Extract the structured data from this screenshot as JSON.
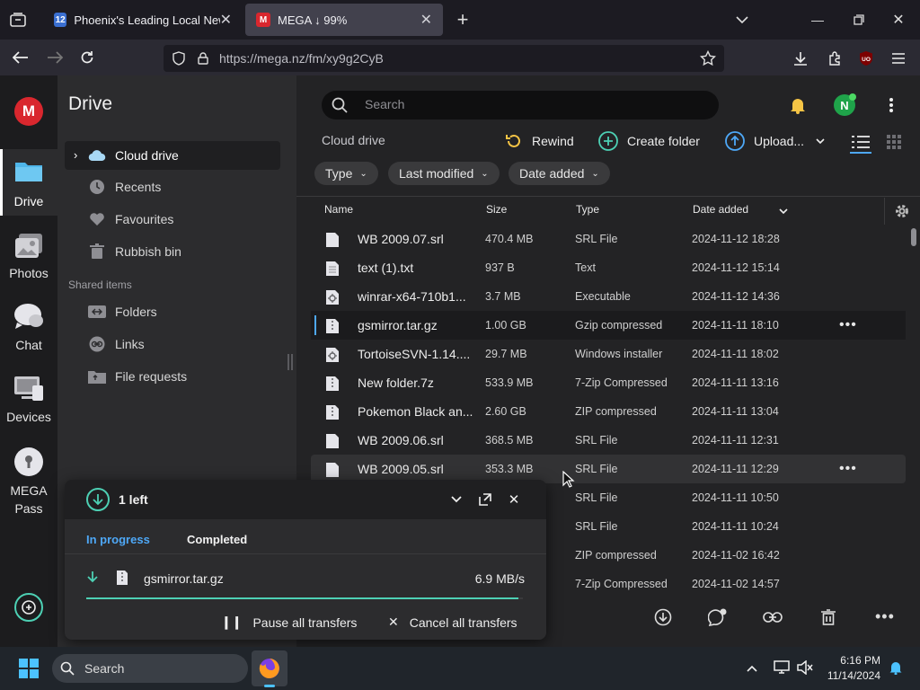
{
  "browser": {
    "tabs": [
      {
        "title": "Phoenix's Leading Local News:",
        "active": false
      },
      {
        "title": "MEGA ↓ 99%",
        "active": true
      }
    ],
    "url": "https://mega.nz/fm/xy9g2CyB"
  },
  "rail": {
    "items": [
      {
        "label": "Drive",
        "icon": "folder-icon",
        "active": true
      },
      {
        "label": "Photos",
        "icon": "photos-icon"
      },
      {
        "label": "Chat",
        "icon": "chat-icon"
      },
      {
        "label": "Devices",
        "icon": "devices-icon"
      },
      {
        "label": "MEGA Pass",
        "icon": "pass-icon"
      }
    ]
  },
  "sidebar": {
    "title": "Drive",
    "items": [
      {
        "label": "Cloud drive",
        "icon": "cloud-icon"
      },
      {
        "label": "Recents",
        "icon": "clock-icon"
      },
      {
        "label": "Favourites",
        "icon": "heart-icon"
      },
      {
        "label": "Rubbish bin",
        "icon": "trash-icon"
      }
    ],
    "shared_title": "Shared items",
    "shared_items": [
      {
        "label": "Folders",
        "icon": "shared-folder-icon"
      },
      {
        "label": "Links",
        "icon": "link-icon"
      },
      {
        "label": "File requests",
        "icon": "file-request-icon"
      }
    ]
  },
  "topbar": {
    "search_placeholder": "Search",
    "avatar_letter": "N"
  },
  "toolbar": {
    "breadcrumb": "Cloud drive",
    "rewind": "Rewind",
    "create_folder": "Create folder",
    "upload": "Upload..."
  },
  "filters": [
    "Type",
    "Last modified",
    "Date added"
  ],
  "table": {
    "columns": {
      "name": "Name",
      "size": "Size",
      "type": "Type",
      "date": "Date added"
    },
    "rows": [
      {
        "name": "WB 2009.07.srl",
        "size": "470.4 MB",
        "type": "SRL File",
        "date": "2024-11-12 18:28"
      },
      {
        "name": "text (1).txt",
        "size": "937 B",
        "type": "Text",
        "date": "2024-11-12 15:14"
      },
      {
        "name": "winrar-x64-710b1...",
        "size": "3.7 MB",
        "type": "Executable",
        "date": "2024-11-12 14:36"
      },
      {
        "name": "gsmirror.tar.gz",
        "size": "1.00 GB",
        "type": "Gzip compressed",
        "date": "2024-11-11 18:10"
      },
      {
        "name": "TortoiseSVN-1.14....",
        "size": "29.7 MB",
        "type": "Windows installer",
        "date": "2024-11-11 18:02"
      },
      {
        "name": "New folder.7z",
        "size": "533.9 MB",
        "type": "7-Zip Compressed",
        "date": "2024-11-11 13:16"
      },
      {
        "name": "Pokemon Black an...",
        "size": "2.60 GB",
        "type": "ZIP compressed",
        "date": "2024-11-11 13:04"
      },
      {
        "name": "WB 2009.06.srl",
        "size": "368.5 MB",
        "type": "SRL File",
        "date": "2024-11-11 12:31"
      },
      {
        "name": "WB 2009.05.srl",
        "size": "353.3 MB",
        "type": "SRL File",
        "date": "2024-11-11 12:29"
      },
      {
        "name": "",
        "size": "",
        "type": "SRL File",
        "date": "2024-11-11 10:50"
      },
      {
        "name": "",
        "size": "",
        "type": "SRL File",
        "date": "2024-11-11 10:24"
      },
      {
        "name": "",
        "size": "",
        "type": "ZIP compressed",
        "date": "2024-11-02 16:42"
      },
      {
        "name": "",
        "size": "",
        "type": "7-Zip Compressed",
        "date": "2024-11-02 14:57"
      }
    ]
  },
  "transfer": {
    "count": "1 left",
    "tab_in_progress": "In progress",
    "tab_completed": "Completed",
    "file_name": "gsmirror.tar.gz",
    "speed": "6.9 MB/s",
    "progress_fraction": 0.99,
    "pause_all": "Pause all transfers",
    "cancel_all": "Cancel all transfers"
  },
  "taskbar": {
    "search": "Search",
    "time": "6:16 PM",
    "date": "11/14/2024"
  },
  "colors": {
    "mega_red": "#d9272e",
    "accent_teal": "#4dd0b4",
    "accent_blue": "#4ea8f7"
  }
}
